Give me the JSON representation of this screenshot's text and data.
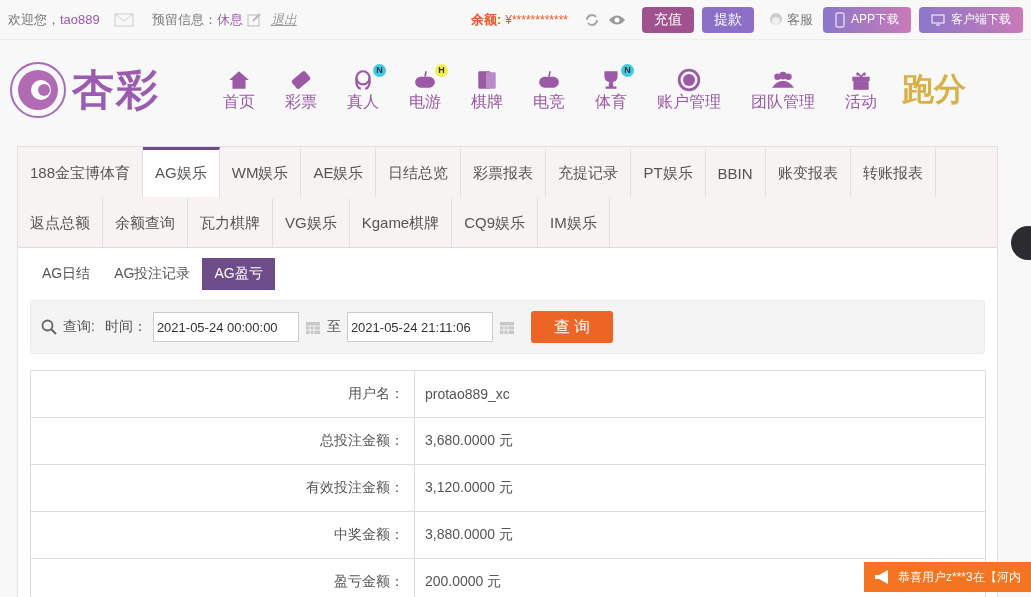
{
  "top_bar": {
    "greeting": "欢迎您，",
    "username": "tao889",
    "reserved_label": "预留信息：",
    "reserved_value": "休息",
    "logout": "退出",
    "balance_label": "余额:",
    "balance_value": "¥************",
    "deposit": "充值",
    "withdraw": "提款",
    "service": "客服",
    "app_download": "APP下载",
    "client_download": "客户端下载"
  },
  "logo_text": "杏彩",
  "nav": [
    {
      "label": "首页"
    },
    {
      "label": "彩票"
    },
    {
      "label": "真人",
      "badge": "N",
      "color": "#3fc9e8"
    },
    {
      "label": "电游",
      "badge": "H",
      "color": "#f2ee4a"
    },
    {
      "label": "棋牌"
    },
    {
      "label": "电竞"
    },
    {
      "label": "体育",
      "badge": "N",
      "color": "#3fc9e8"
    },
    {
      "label": "账户管理"
    },
    {
      "label": "团队管理"
    },
    {
      "label": "活动"
    }
  ],
  "promo_text": "跑分",
  "tab_rows": [
    [
      {
        "label": "188金宝博体育",
        "selected": false
      },
      {
        "label": "AG娱乐",
        "selected": true
      },
      {
        "label": "WM娱乐",
        "selected": false
      },
      {
        "label": "AE娱乐",
        "selected": false
      },
      {
        "label": "日结总览",
        "selected": false
      },
      {
        "label": "彩票报表",
        "selected": false
      },
      {
        "label": "充提记录",
        "selected": false
      },
      {
        "label": "PT娱乐",
        "selected": false
      },
      {
        "label": "BBIN",
        "selected": false
      },
      {
        "label": "账变报表",
        "selected": false
      },
      {
        "label": "转账报表",
        "selected": false
      }
    ],
    [
      {
        "label": "返点总额",
        "selected": false
      },
      {
        "label": "余额查询",
        "selected": false
      },
      {
        "label": "瓦力棋牌",
        "selected": false
      },
      {
        "label": "VG娱乐",
        "selected": false
      },
      {
        "label": "Kgame棋牌",
        "selected": false
      },
      {
        "label": "CQ9娱乐",
        "selected": false
      },
      {
        "label": "IM娱乐",
        "selected": false
      }
    ]
  ],
  "sub_tabs": [
    {
      "label": "AG日结",
      "selected": false
    },
    {
      "label": "AG投注记录",
      "selected": false
    },
    {
      "label": "AG盈亏",
      "selected": true
    }
  ],
  "query": {
    "label": "查询:",
    "time_label": "时间：",
    "start": "2021-05-24 00:00:00",
    "to": "至",
    "end": "2021-05-24 21:11:06",
    "button": "查 询"
  },
  "summary": [
    {
      "label": "用户名：",
      "value": "protao889_xc"
    },
    {
      "label": "总投注金额：",
      "value": "3,680.0000 元"
    },
    {
      "label": "有效投注金额：",
      "value": "3,120.0000 元"
    },
    {
      "label": "中奖金额：",
      "value": "3,880.0000 元"
    },
    {
      "label": "盈亏金额：",
      "value": "200.0000 元"
    }
  ],
  "notice": "恭喜用户z***3在【河内"
}
